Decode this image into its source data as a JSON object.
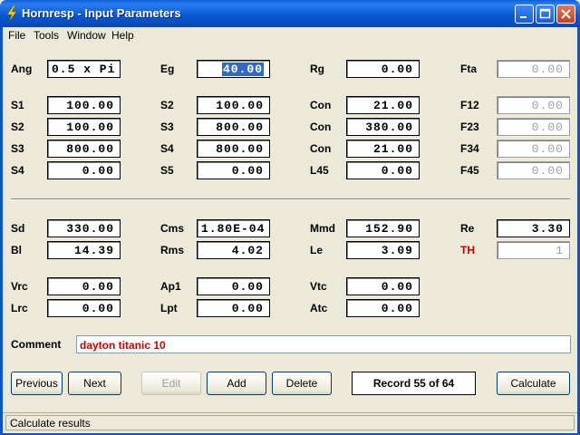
{
  "window": {
    "title": "Hornresp - Input Parameters"
  },
  "menu": {
    "file": "File",
    "tools": "Tools",
    "window": "Window",
    "help": "Help"
  },
  "rows": {
    "ang": {
      "label": "Ang",
      "value": "0.5 x Pi"
    },
    "eg": {
      "label": "Eg",
      "value": "40.00"
    },
    "rg": {
      "label": "Rg",
      "value": "0.00"
    },
    "fta": {
      "label": "Fta",
      "value": "0.00"
    },
    "s1": {
      "label": "S1",
      "value": "100.00"
    },
    "s2a": {
      "label": "S2",
      "value": "100.00"
    },
    "con1": {
      "label": "Con",
      "value": "21.00"
    },
    "f12": {
      "label": "F12",
      "value": "0.00"
    },
    "s2b": {
      "label": "S2",
      "value": "100.00"
    },
    "s3a": {
      "label": "S3",
      "value": "800.00"
    },
    "con2": {
      "label": "Con",
      "value": "380.00"
    },
    "f23": {
      "label": "F23",
      "value": "0.00"
    },
    "s3b": {
      "label": "S3",
      "value": "800.00"
    },
    "s4a": {
      "label": "S4",
      "value": "800.00"
    },
    "con3": {
      "label": "Con",
      "value": "21.00"
    },
    "f34": {
      "label": "F34",
      "value": "0.00"
    },
    "s4b": {
      "label": "S4",
      "value": "0.00"
    },
    "s5": {
      "label": "S5",
      "value": "0.00"
    },
    "l45": {
      "label": "L45",
      "value": "0.00"
    },
    "f45": {
      "label": "F45",
      "value": "0.00"
    },
    "sd": {
      "label": "Sd",
      "value": "330.00"
    },
    "cms": {
      "label": "Cms",
      "value": "1.80E-04"
    },
    "mmd": {
      "label": "Mmd",
      "value": "152.90"
    },
    "re": {
      "label": "Re",
      "value": "3.30"
    },
    "bl": {
      "label": "Bl",
      "value": "14.39"
    },
    "rms": {
      "label": "Rms",
      "value": "4.02"
    },
    "le": {
      "label": "Le",
      "value": "3.09"
    },
    "th": {
      "label": "TH",
      "value": "1"
    },
    "vrc": {
      "label": "Vrc",
      "value": "0.00"
    },
    "ap1": {
      "label": "Ap1",
      "value": "0.00"
    },
    "vtc": {
      "label": "Vtc",
      "value": "0.00"
    },
    "lrc": {
      "label": "Lrc",
      "value": "0.00"
    },
    "lpt": {
      "label": "Lpt",
      "value": "0.00"
    },
    "atc": {
      "label": "Atc",
      "value": "0.00"
    }
  },
  "comment": {
    "label": "Comment",
    "value": "dayton titanic 10"
  },
  "buttons": {
    "previous": "Previous",
    "next": "Next",
    "edit": "Edit",
    "add": "Add",
    "delete": "Delete",
    "record": "Record 55 of 64",
    "calculate": "Calculate"
  },
  "status": {
    "text": "Calculate results"
  },
  "colors": {
    "accent": "#cc0000",
    "titlebar": "#0a5fd8",
    "selection": "#316ac5"
  }
}
